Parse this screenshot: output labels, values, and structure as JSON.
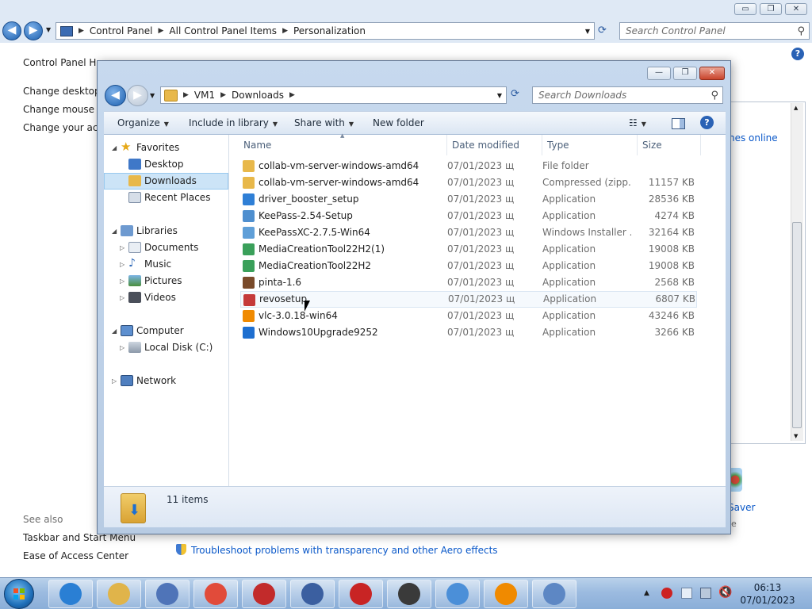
{
  "cp_window": {
    "caption_buttons": {
      "minimize": "▭",
      "maximize": "❐",
      "close": "✕"
    },
    "address": {
      "breadcrumbs": [
        "Control Panel",
        "All Control Panel Items",
        "Personalization"
      ]
    },
    "search_placeholder": "Search Control Panel",
    "left_links": [
      "Control Panel Ho",
      "Change desktop i",
      "Change mouse po",
      "Change your acco"
    ],
    "see_also": {
      "heading": "See also",
      "links": [
        "Taskbar and Start Menu",
        "Ease of Access Center"
      ]
    },
    "right_fragments": {
      "online_link": "nes online",
      "saver_link": "Saver",
      "saver_sub": "e"
    },
    "troubleshoot_link": "Troubleshoot problems with transparency and other Aero effects"
  },
  "explorer": {
    "address": {
      "breadcrumbs": [
        "VM1",
        "Downloads"
      ]
    },
    "search_placeholder": "Search Downloads",
    "toolbar": {
      "organize": "Organize",
      "include_in_library": "Include in library",
      "share_with": "Share with",
      "new_folder": "New folder"
    },
    "nav": {
      "favorites": {
        "label": "Favorites",
        "items": [
          "Desktop",
          "Downloads",
          "Recent Places"
        ],
        "selected": "Downloads"
      },
      "libraries": {
        "label": "Libraries",
        "items": [
          "Documents",
          "Music",
          "Pictures",
          "Videos"
        ]
      },
      "computer": {
        "label": "Computer",
        "items": [
          "Local Disk (C:)"
        ]
      },
      "network": {
        "label": "Network"
      }
    },
    "columns": [
      "Name",
      "Date modified",
      "Type",
      "Size"
    ],
    "files": [
      {
        "name": "collab-vm-server-windows-amd64",
        "date": "07/01/2023 щ",
        "type": "File folder",
        "size": "",
        "icon": "folder-icon",
        "color": "#e8b84a"
      },
      {
        "name": "collab-vm-server-windows-amd64",
        "date": "07/01/2023 щ",
        "type": "Compressed (zipp...",
        "size": "11157 KB",
        "icon": "zip-folder-icon",
        "color": "#e8b84a"
      },
      {
        "name": "driver_booster_setup",
        "date": "07/01/2023 щ",
        "type": "Application",
        "size": "28536 KB",
        "icon": "driver-booster-icon",
        "color": "#2f7fd6"
      },
      {
        "name": "KeePass-2.54-Setup",
        "date": "07/01/2023 щ",
        "type": "Application",
        "size": "4274 KB",
        "icon": "installer-icon",
        "color": "#4f8fcf"
      },
      {
        "name": "KeePassXC-2.7.5-Win64",
        "date": "07/01/2023 щ",
        "type": "Windows Installer ...",
        "size": "32164 KB",
        "icon": "msi-installer-icon",
        "color": "#5f9fd8"
      },
      {
        "name": "MediaCreationTool22H2(1)",
        "date": "07/01/2023 щ",
        "type": "Application",
        "size": "19008 KB",
        "icon": "media-creation-tool-icon",
        "color": "#3aa05a"
      },
      {
        "name": "MediaCreationTool22H2",
        "date": "07/01/2023 щ",
        "type": "Application",
        "size": "19008 KB",
        "icon": "media-creation-tool-icon",
        "color": "#3aa05a"
      },
      {
        "name": "pinta-1.6",
        "date": "07/01/2023 щ",
        "type": "Application",
        "size": "2568 KB",
        "icon": "paintbrush-icon",
        "color": "#7a4b2a"
      },
      {
        "name": "revosetup",
        "date": "07/01/2023 щ",
        "type": "Application",
        "size": "6807 KB",
        "icon": "revo-uninstaller-icon",
        "color": "#c53a3a"
      },
      {
        "name": "vlc-3.0.18-win64",
        "date": "07/01/2023 щ",
        "type": "Application",
        "size": "43246 KB",
        "icon": "vlc-cone-icon",
        "color": "#f08a00"
      },
      {
        "name": "Windows10Upgrade9252",
        "date": "07/01/2023 щ",
        "type": "Application",
        "size": "3266 KB",
        "icon": "windows-logo-icon",
        "color": "#1e6fd0"
      }
    ],
    "hovered_file": "revosetup",
    "status": "11 items"
  },
  "taskbar": {
    "apps": [
      "internet-explorer-icon",
      "file-explorer-icon",
      "media-player-icon",
      "chrome-icon",
      "driver-booster-icon",
      "imaging-tool-icon",
      "screen-recorder-icon",
      "keepass-lock-icon",
      "paper-plane-icon",
      "vlc-cone-icon",
      "system-tool-icon"
    ],
    "clock": {
      "time": "06:13",
      "date": "07/01/2023"
    }
  },
  "colors": {
    "accent": "#1f6fb9",
    "link": "#0a58c9",
    "selection": "#cce4f7"
  }
}
